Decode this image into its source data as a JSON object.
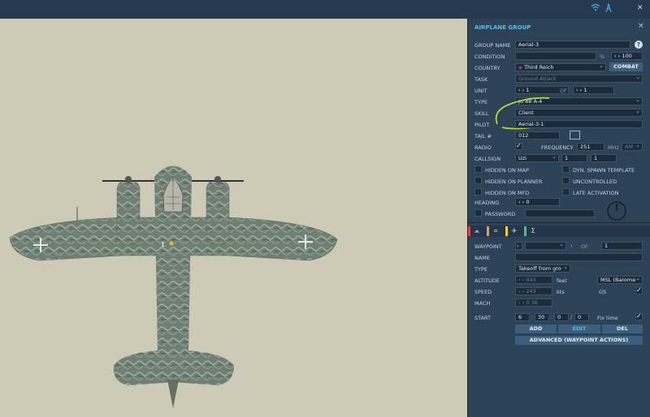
{
  "topbar": {
    "icons": [
      "wifi-icon",
      "antenna-icon"
    ],
    "close": "✕"
  },
  "panel": {
    "title": "AIRPLANE GROUP",
    "help": "?",
    "close": "✕",
    "group_name": {
      "label": "GROUP NAME",
      "value": "Aerial-3"
    },
    "condition": {
      "label": "CONDITION",
      "percent": "%",
      "value": "100"
    },
    "country": {
      "label": "COUNTRY",
      "value": "Third Reich",
      "combat": "COMBAT"
    },
    "task": {
      "label": "TASK",
      "value": "Ground Attack"
    },
    "unit": {
      "label": "UNIT",
      "value": "1",
      "of": "OF",
      "of_value": "1"
    },
    "type": {
      "label": "TYPE",
      "value": "Ju 88 A-4"
    },
    "skill": {
      "label": "SKILL",
      "value": "Client"
    },
    "pilot": {
      "label": "PILOT",
      "value": "Aerial-3-1"
    },
    "tail": {
      "label": "TAIL #",
      "value": "012"
    },
    "radio": {
      "label": "RADIO",
      "freq_label": "FREQUENCY",
      "freq": "251",
      "mhz": "MHz",
      "mod": "AM"
    },
    "callsign": {
      "label": "CALLSIGN",
      "name": "Uzi",
      "n1": "1",
      "n2": "1"
    },
    "options": {
      "hidden_map": "HIDDEN ON MAP",
      "hidden_planner": "HIDDEN ON PLANNER",
      "hidden_mfd": "HIDDEN ON MFD",
      "dyn_spawn": "DYN. SPAWN TEMPLATE",
      "uncontrolled": "UNCONTROLLED",
      "late_activation": "LATE ACTIVATION"
    },
    "heading": {
      "label": "HEADING",
      "value": "0"
    },
    "password": {
      "label": "PASSWORD"
    },
    "tabs": [
      "route-tab",
      "payload-tab",
      "aircraft-tab",
      "summary-tab"
    ],
    "tab_colors": [
      "#e04646",
      "#e8a23a",
      "#e8d23a",
      "#3ac77a"
    ],
    "waypoint": {
      "label": "WAYPOINT",
      "of": "OF",
      "of_value": "1",
      "name_label": "NAME",
      "type_label": "TYPE",
      "type_value": "Takeoff from gro",
      "altitude_label": "ALTITUDE",
      "altitude": "443",
      "feet": "feet",
      "alt_ref": "MSL (Barome",
      "speed_label": "SPEED",
      "speed": "243",
      "kts": "kts",
      "gs": "GS",
      "mach_label": "MACH",
      "mach": "0.36",
      "start_label": "START",
      "h": "6",
      "m": "30",
      "s": "0",
      "ms": "0",
      "fix_time": "Fix time",
      "add": "ADD",
      "edit": "EDIT",
      "del": "DEL",
      "advanced": "ADVANCED (WAYPOINT ACTIONS)"
    }
  },
  "map": {
    "unit_number": "1"
  }
}
